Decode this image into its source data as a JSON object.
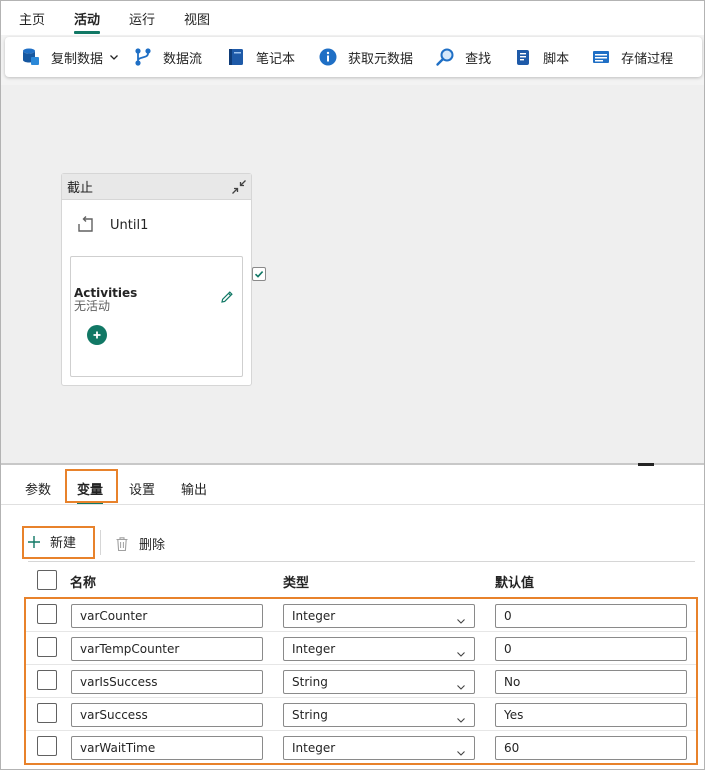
{
  "menu": {
    "items": [
      {
        "label": "主页"
      },
      {
        "label": "活动",
        "active": true
      },
      {
        "label": "运行"
      },
      {
        "label": "视图"
      }
    ]
  },
  "ribbon": {
    "copy_data": "复制数据",
    "dataflow": "数据流",
    "notebook": "笔记本",
    "get_metadata": "获取元数据",
    "lookup": "查找",
    "script": "脚本",
    "stored_procedure": "存储过程"
  },
  "until_card": {
    "type_label": "截止",
    "name": "Until1",
    "activities_title": "Activities",
    "activities_empty": "无活动"
  },
  "tabs": {
    "parameters": "参数",
    "variables": "变量",
    "settings": "设置",
    "output": "输出"
  },
  "toolbar": {
    "new_label": "新建",
    "delete_label": "删除"
  },
  "table": {
    "headers": {
      "name": "名称",
      "type": "类型",
      "default": "默认值"
    },
    "rows": [
      {
        "name": "varCounter",
        "type": "Integer",
        "default": "0"
      },
      {
        "name": "varTempCounter",
        "type": "Integer",
        "default": "0"
      },
      {
        "name": "varIsSuccess",
        "type": "String",
        "default": "No"
      },
      {
        "name": "varSuccess",
        "type": "String",
        "default": "Yes"
      },
      {
        "name": "varWaitTime",
        "type": "Integer",
        "default": "60"
      }
    ]
  },
  "colors": {
    "accent": "#117865",
    "highlight": "#e8822b",
    "canvas": "#efefef"
  }
}
